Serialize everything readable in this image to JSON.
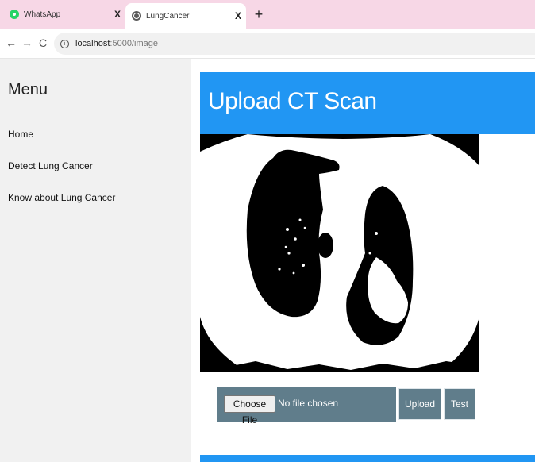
{
  "browser": {
    "tabs": [
      {
        "title": "WhatsApp",
        "icon": "whatsapp-icon",
        "close": "X"
      },
      {
        "title": "LungCancer",
        "icon": "globe-icon",
        "close": "X"
      }
    ],
    "new_tab": "+",
    "nav": {
      "back": "←",
      "forward": "→",
      "reload": "C"
    },
    "url_host": "localhost",
    "url_path": ":5000/image"
  },
  "sidebar": {
    "title": "Menu",
    "items": [
      {
        "label": "Home"
      },
      {
        "label": "Detect Lung Cancer"
      },
      {
        "label": "Know about Lung Cancer"
      }
    ]
  },
  "main": {
    "header_title": "Upload CT Scan",
    "file_input": {
      "button_label": "Choose File",
      "status": "No file chosen"
    },
    "upload_label": "Upload",
    "test_label": "Test"
  },
  "colors": {
    "header_blue": "#2196f3",
    "form_gray": "#607d8b",
    "tab_bar_pink": "#f7d7e6",
    "sidebar_bg": "#f1f1f1"
  }
}
